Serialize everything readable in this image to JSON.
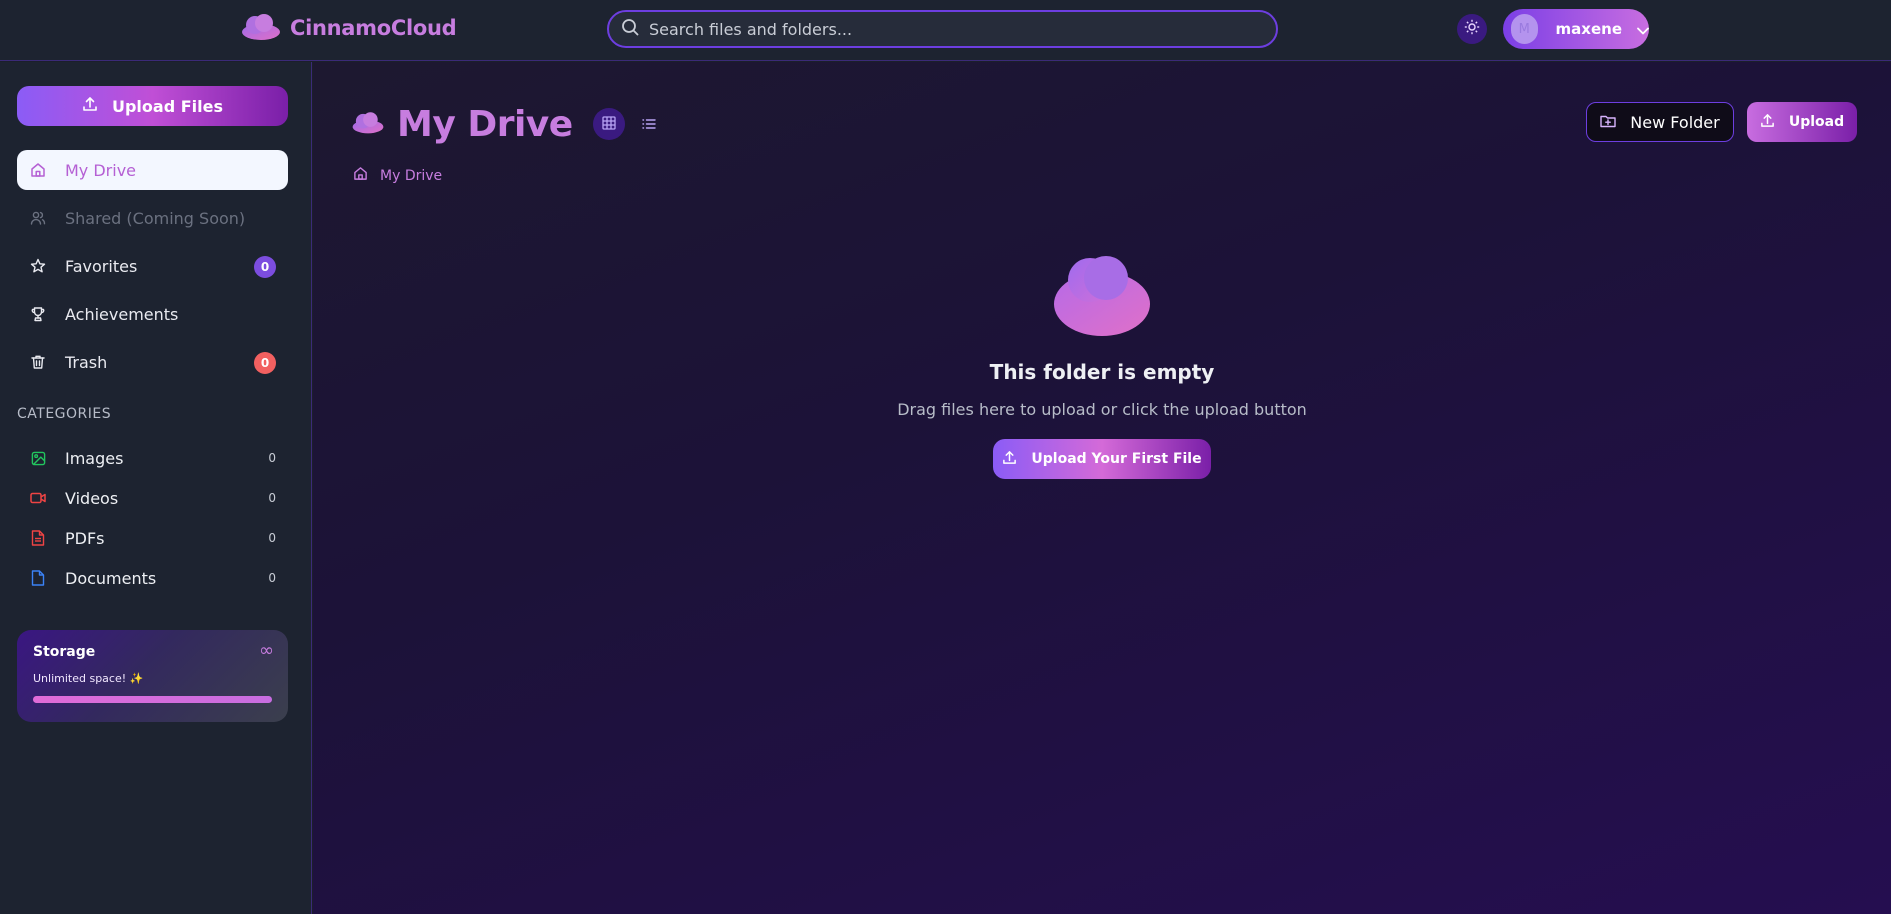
{
  "brand": {
    "name": "CinnamoCloud"
  },
  "search": {
    "placeholder": "Search files and folders..."
  },
  "user": {
    "initial": "M",
    "name": "maxene"
  },
  "sidebar": {
    "upload_label": "Upload Files",
    "nav": [
      {
        "label": "My Drive",
        "icon": "home-icon"
      },
      {
        "label": "Shared (Coming Soon)",
        "icon": "users-icon"
      },
      {
        "label": "Favorites",
        "icon": "star-icon",
        "badge": "0"
      },
      {
        "label": "Achievements",
        "icon": "trophy-icon"
      },
      {
        "label": "Trash",
        "icon": "trash-icon",
        "badge": "0"
      }
    ],
    "categories_label": "CATEGORIES",
    "categories": [
      {
        "label": "Images",
        "count": "0",
        "icon": "image-icon",
        "color": "#22c55e"
      },
      {
        "label": "Videos",
        "count": "0",
        "icon": "video-icon",
        "color": "#ef4444"
      },
      {
        "label": "PDFs",
        "count": "0",
        "icon": "pdf-icon",
        "color": "#ef4444"
      },
      {
        "label": "Documents",
        "count": "0",
        "icon": "document-icon",
        "color": "#3b82f6"
      }
    ],
    "storage": {
      "title": "Storage",
      "symbol": "∞",
      "subtitle": "Unlimited space! ✨",
      "fill_fraction": 1.0
    }
  },
  "main": {
    "title": "My Drive",
    "new_folder_label": "New Folder",
    "upload_label": "Upload",
    "breadcrumb": "My Drive",
    "empty": {
      "title": "This folder is empty",
      "subtitle": "Drag files here to upload or click the upload button",
      "button_label": "Upload Your First File"
    }
  },
  "colors": {
    "accent": "#c77ddf",
    "primary": "#7c3aed",
    "danger": "#f26060"
  }
}
